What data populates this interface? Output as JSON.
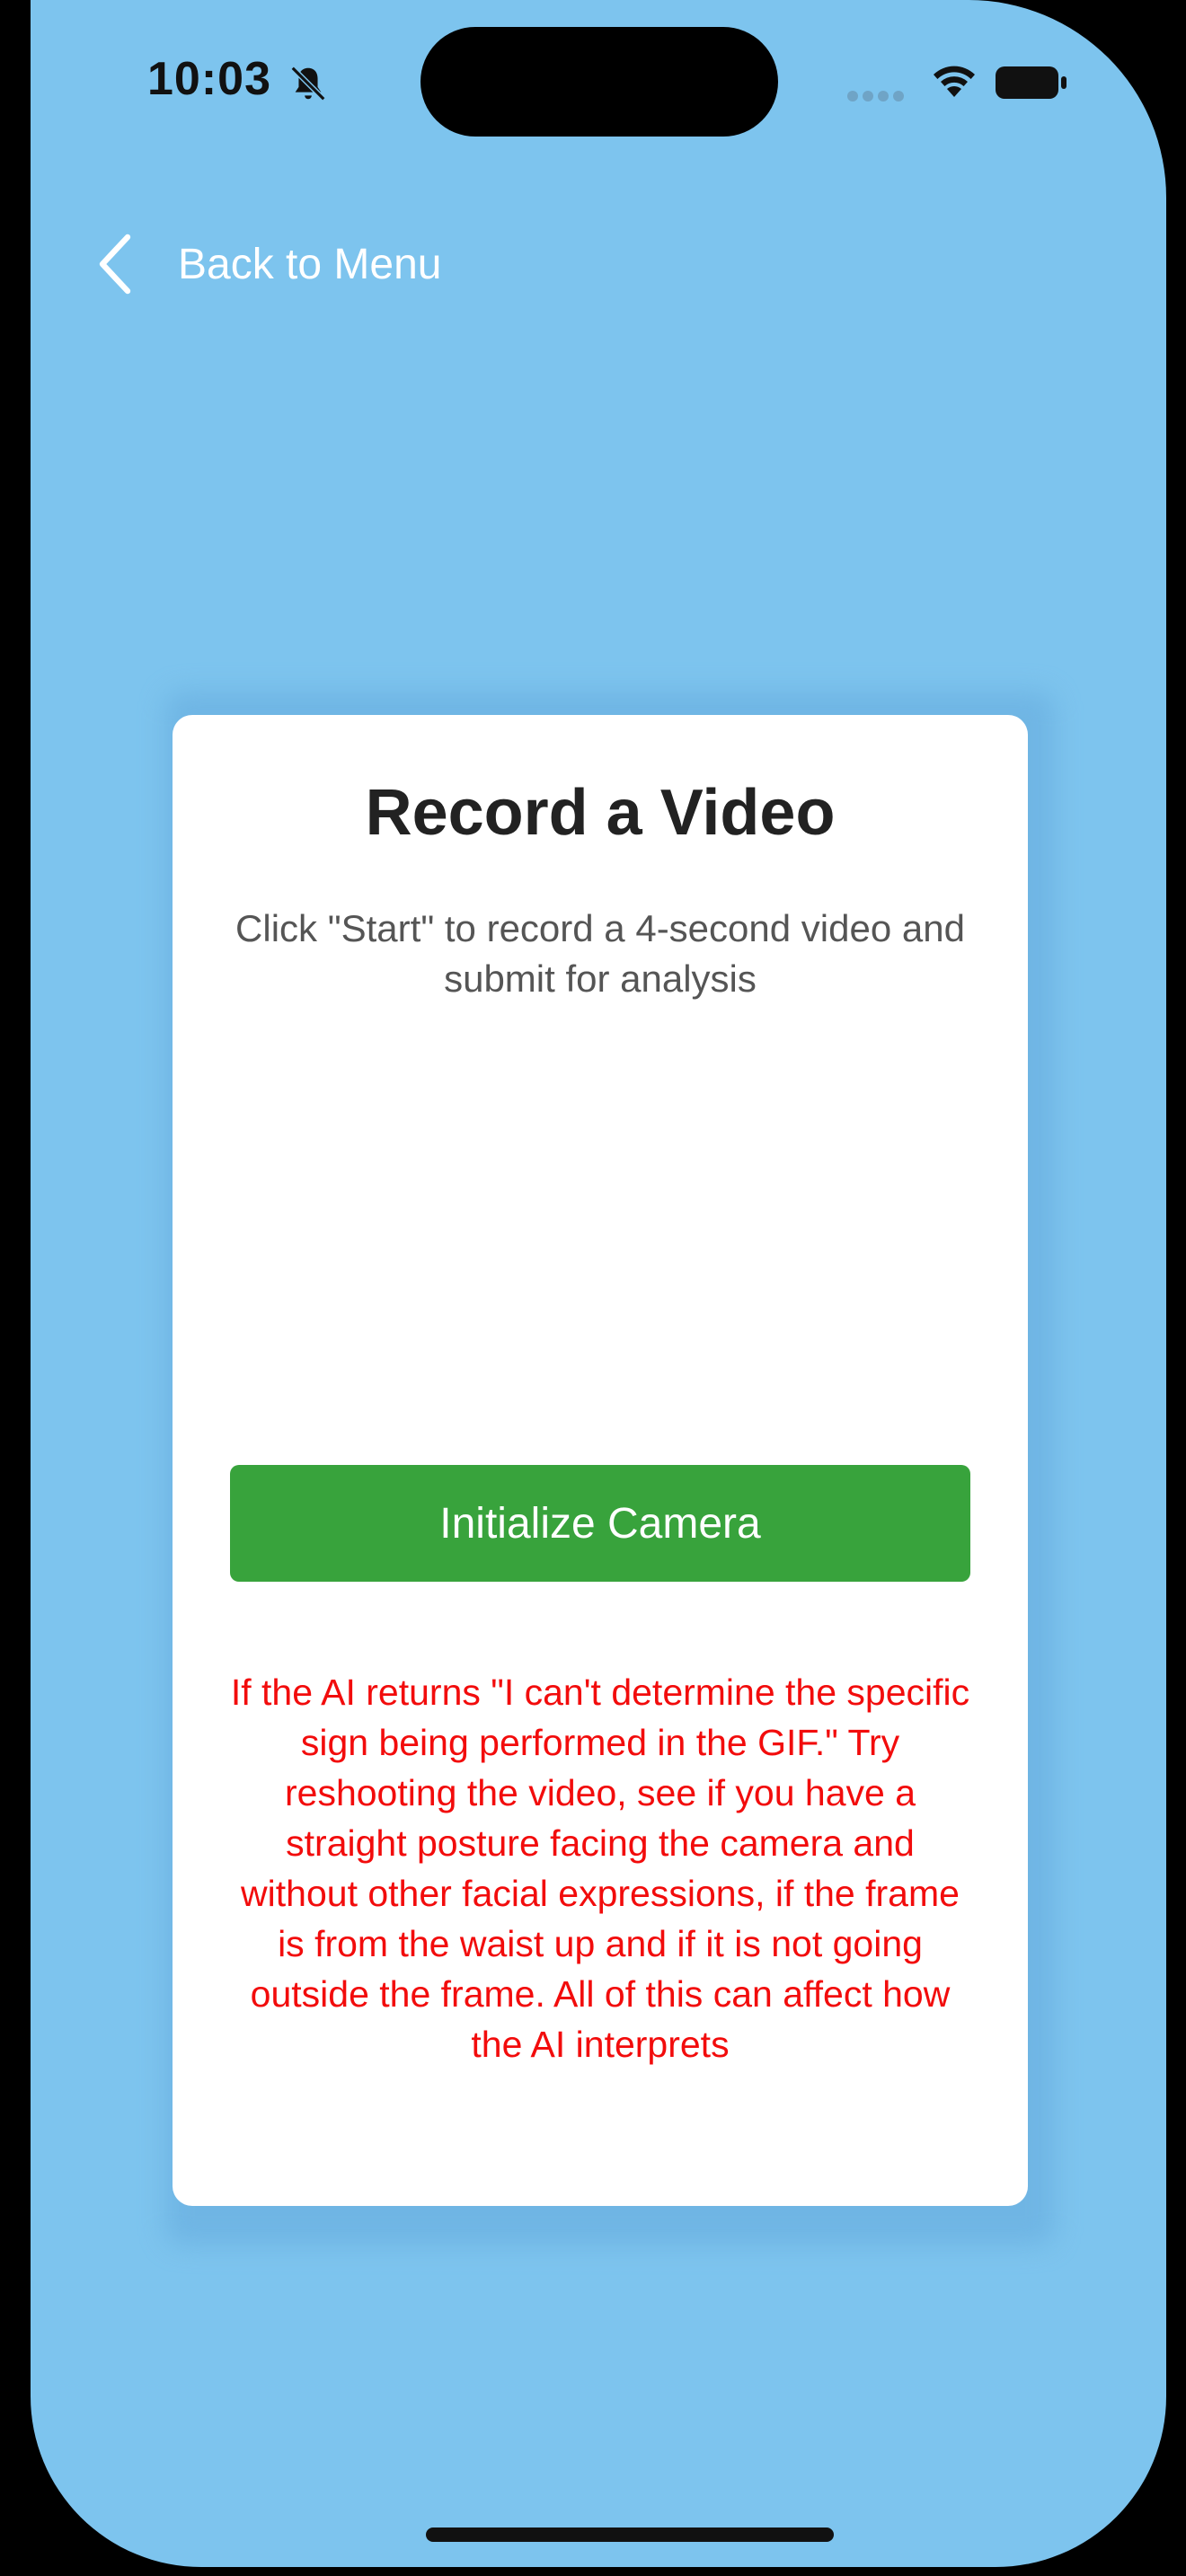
{
  "status_bar": {
    "time": "10:03",
    "icons": [
      "bell-slash-icon",
      "signal-icon",
      "wifi-icon",
      "battery-icon"
    ]
  },
  "nav": {
    "back_label": "Back to Menu",
    "back_icon": "chevron-left-icon"
  },
  "card": {
    "title": "Record a Video",
    "subtitle": "Click \"Start\" to record a 4-second video and submit for analysis",
    "button_label": "Initialize Camera",
    "warning": "If the AI returns \"I can't determine the specific sign being performed in the GIF.\" Try reshooting the video, see if you have a straight posture facing the camera and without other facial expressions, if the frame is from the waist up and if it is not going outside the frame. All of this can affect how the AI interprets"
  },
  "colors": {
    "background": "#7DC4EE",
    "card": "#FFFFFF",
    "button": "#38A33C",
    "warning": "#F20C0C",
    "title": "#222222"
  }
}
